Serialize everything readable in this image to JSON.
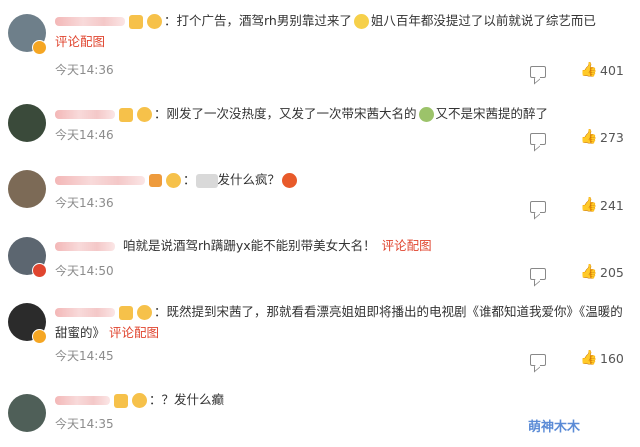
{
  "comments": [
    {
      "text_a": "：打个广告，酒驾rh男别靠过来了",
      "text_b": "姐八百年都没提过了以前就说了综艺而已",
      "link": "评论配图",
      "time": "今天14:36",
      "likes": "401",
      "avatar_color": "#6e7f8a"
    },
    {
      "text_a": "：刚发了一次没热度，又发了一次带宋茜大名的",
      "text_b": "又不是宋茜提的醉了",
      "link": "",
      "time": "今天14:46",
      "likes": "273",
      "avatar_color": "#3a4a3a"
    },
    {
      "text_a": "：",
      "text_b": "发什么疯？",
      "link": "",
      "time": "今天14:36",
      "likes": "241",
      "avatar_color": "#7c6a56"
    },
    {
      "text_a": "咱就是说酒驾rh蹒跚yx能不能别带美女大名！",
      "text_b": "",
      "link": "评论配图",
      "time": "今天14:50",
      "likes": "205",
      "avatar_color": "#5c6670"
    },
    {
      "text_a": "：既然提到宋茜了，那就看看漂亮姐姐即将播出的电视剧《谁都知道我爱你》《温暖的",
      "text_b": "甜蜜的》",
      "link": "评论配图",
      "time": "今天14:45",
      "likes": "160",
      "avatar_color": "#2b2b2b"
    },
    {
      "text_a": "：？发什么癫",
      "text_b": "",
      "link": "",
      "time": "今天14:35",
      "likes": "",
      "avatar_color": "#4f5f58"
    }
  ],
  "watermark": "萌神木木",
  "icons": {
    "reply": "comment-icon",
    "like": "thumbs-up-icon"
  }
}
